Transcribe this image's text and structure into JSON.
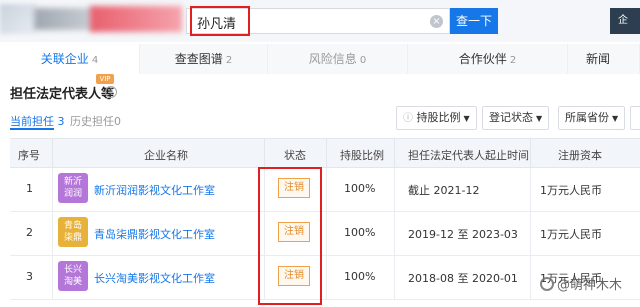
{
  "search": {
    "value": "孙凡清",
    "button_label": "查一下"
  },
  "tabs": [
    {
      "label": "关联企业",
      "count": "4"
    },
    {
      "label": "查查图谱",
      "count": "2"
    },
    {
      "label": "风险信息",
      "count": "0"
    },
    {
      "label": "合作伙伴",
      "count": "2"
    },
    {
      "label": "新闻",
      "count": ""
    }
  ],
  "section": {
    "title": "担任法定代表人等",
    "vip": "VIP",
    "subtabs": [
      {
        "label": "当前担任",
        "count": "3"
      },
      {
        "label": "历史担任",
        "count": "0"
      }
    ],
    "filters": [
      "持股比例",
      "登记状态",
      "所属省份"
    ]
  },
  "table": {
    "headers": [
      "序号",
      "企业名称",
      "状态",
      "持股比例",
      "担任法定代表人起止时间",
      "注册资本"
    ],
    "rows": [
      {
        "index": "1",
        "logo": [
          "新沂",
          "润润"
        ],
        "logo_color": "#b476d9",
        "name": "新沂润润影视文化工作室",
        "status": "注销",
        "share": "100%",
        "period": "截止 2021-12",
        "capital": "1万元人民币"
      },
      {
        "index": "2",
        "logo": [
          "青岛",
          "柒鼎"
        ],
        "logo_color": "#e8b23a",
        "name": "青岛柒鼎影视文化工作室",
        "status": "注销",
        "share": "100%",
        "period": "2019-12 至 2023-03",
        "capital": "1万元人民币"
      },
      {
        "index": "3",
        "logo": [
          "长兴",
          "淘美"
        ],
        "logo_color": "#b476d9",
        "name": "长兴淘美影视文化工作室",
        "status": "注销",
        "share": "100%",
        "period": "2018-08 至 2020-01",
        "capital": "1万元人民币"
      }
    ]
  },
  "watermark": "@萌神木木",
  "colors": {
    "accent": "#1677e8",
    "highlight": "#e02020",
    "status": "#e08a2a"
  }
}
